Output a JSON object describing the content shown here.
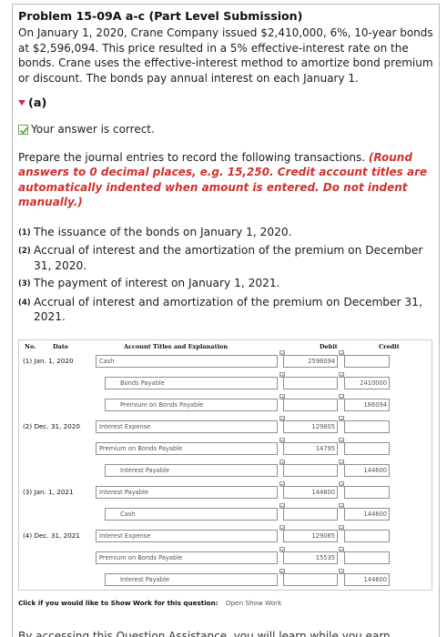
{
  "problem": {
    "title": "Problem 15-09A a-c (Part Level Submission)",
    "text": "On January 1, 2020, Crane Company issued $2,410,000, 6%, 10-year bonds at $2,596,094. This price resulted in a 5% effective-interest rate on the bonds. Crane uses the effective-interest method to amortize bond premium or discount. The bonds pay annual interest on each January 1."
  },
  "part": {
    "label": "(a)",
    "status": "Your answer is correct."
  },
  "instructions": {
    "lead": "Prepare the journal entries to record the following transactions. ",
    "note": "(Round answers to 0 decimal places, e.g. 15,250. Credit account titles are automatically indented when amount is entered. Do not indent manually.)"
  },
  "tasks": [
    {
      "num": "(1)",
      "text": "The issuance of the bonds on January 1, 2020."
    },
    {
      "num": "(2)",
      "text": "Accrual of interest and the amortization of the premium on December 31, 2020."
    },
    {
      "num": "(3)",
      "text": "The payment of interest on January 1, 2021."
    },
    {
      "num": "(4)",
      "text": "Accrual of interest and amortization of the premium on December 31, 2021."
    }
  ],
  "journal": {
    "headers": {
      "no": "No.",
      "date": "Date",
      "account": "Account Titles and Explanation",
      "debit": "Debit",
      "credit": "Credit"
    },
    "entries": [
      {
        "label": "(1)  Jan. 1, 2020",
        "lines": [
          {
            "account": "Cash",
            "debit": "2596094",
            "credit": ""
          },
          {
            "account": "Bonds Payable",
            "debit": "",
            "credit": "2410000"
          },
          {
            "account": "Premium on Bonds Payable",
            "debit": "",
            "credit": "186094"
          }
        ]
      },
      {
        "label": "(2) Dec. 31, 2020",
        "lines": [
          {
            "account": "Interest Expense",
            "debit": "129805",
            "credit": ""
          },
          {
            "account": "Premium on Bonds Payable",
            "debit": "14795",
            "credit": ""
          },
          {
            "account": "Interest Payable",
            "debit": "",
            "credit": "144600"
          }
        ]
      },
      {
        "label": "(3)  Jan. 1, 2021",
        "lines": [
          {
            "account": "Interest Payable",
            "debit": "144600",
            "credit": ""
          },
          {
            "account": "Cash",
            "debit": "",
            "credit": "144600"
          }
        ]
      },
      {
        "label": "(4) Dec. 31, 2021",
        "lines": [
          {
            "account": "Interest Expense",
            "debit": "129065",
            "credit": ""
          },
          {
            "account": "Premium on Bonds Payable",
            "debit": "15535",
            "credit": ""
          },
          {
            "account": "Interest Payable",
            "debit": "",
            "credit": "144600"
          }
        ]
      }
    ]
  },
  "show_work": {
    "prompt": "Click if you would like to Show Work for this question:",
    "link": "Open Show Work"
  },
  "footer_cutoff": "By accessing this Question Assistance, you will learn while you earn"
}
